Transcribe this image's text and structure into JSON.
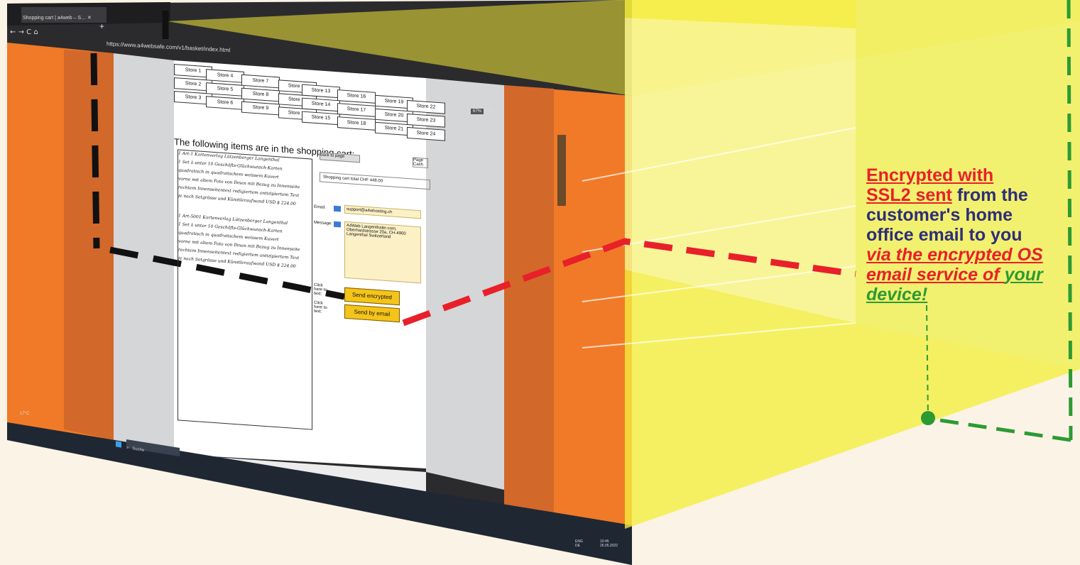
{
  "browser": {
    "tab_title": "Shopping cart | a4web – S… ✕",
    "new_tab": "+",
    "address_url": "https://www.a4websafe.com/v1/basket/index.html",
    "zoom": "67%"
  },
  "page": {
    "stores": [
      "Store 1",
      "Store 2",
      "Store 3",
      "Store 4",
      "Store 5",
      "Store 6",
      "Store 7",
      "Store 8",
      "Store 9",
      "Store 10",
      "Store 11",
      "Store 12",
      "Store 13",
      "Store 14",
      "Store 15",
      "Store 16",
      "Store 17",
      "Store 18",
      "Store 19",
      "Store 20",
      "Store 21",
      "Store 22",
      "Store 23",
      "Store 24"
    ],
    "cart_heading": "The following items are in the shopping cart:",
    "cart_items": [
      "1  Art-1   Kartenverlag Lützenberger Langenthal",
      "1 Set à unter 10 Geschäfts-Glückwunsch-Karten",
      "quadratisch in quadratischem weissem Kuvert",
      "vorne mit altem Foto von Ihnen mit Bezug zu Innenseite",
      "rechtem Innenseitentext redigiertem antizipiertem Text",
      "je nach Setgrösse und Künstleraufwand USD $ 224.00",
      "1  Art-5001   Kartenverlag Lützenberger Langenthal",
      "1 Set à unter 10 Geschäfts-Glückwunsch-Karten",
      "quadratisch in quadratischem weissem Kuvert",
      "vorne mit altem Foto von Ihnen mit Bezug zu Innenseite",
      "rechtem Innenseitentext redigiertem antizipiertem Text",
      "je nach Setgrösse und Künstleraufwand USD $ 224.00"
    ],
    "back_to_page": "back to page",
    "page_cash": "Page Cash",
    "total": "Shopping cart total CHF 448.00",
    "email_label": "Email:",
    "email_value": "support@a4whosting.ch",
    "message_label": "Message:",
    "message_value": "A4Web Langenthaler.com, Oberhardstrasse 20a, CH-4900 Langenthal Switzerland",
    "click_here_text": "Click here to text:",
    "send_encrypted": "Send encrypted",
    "send_by_email": "Send by email"
  },
  "taskbar": {
    "search": "Suche",
    "weather": "17°C",
    "lang": "ENG DE",
    "time": "10:45",
    "date": "26.05.2022"
  },
  "annotation": {
    "line1": "Encrypted with",
    "line2a": "SSL2 sent",
    "line2b": " from the",
    "line3": "customer's home",
    "line4": "office email to you",
    "line5": "via the encrypted OS",
    "line6a": "email service of ",
    "line6b": "your",
    "line7": "device!"
  },
  "colors": {
    "orange": "#f07a28",
    "yellow_overlay": "#f5e93a",
    "red_dash": "#e8202a",
    "green_dash": "#2c9a34",
    "black_dash": "#111111",
    "accent_red": "#e8202a",
    "accent_navy": "#2d2e78"
  }
}
